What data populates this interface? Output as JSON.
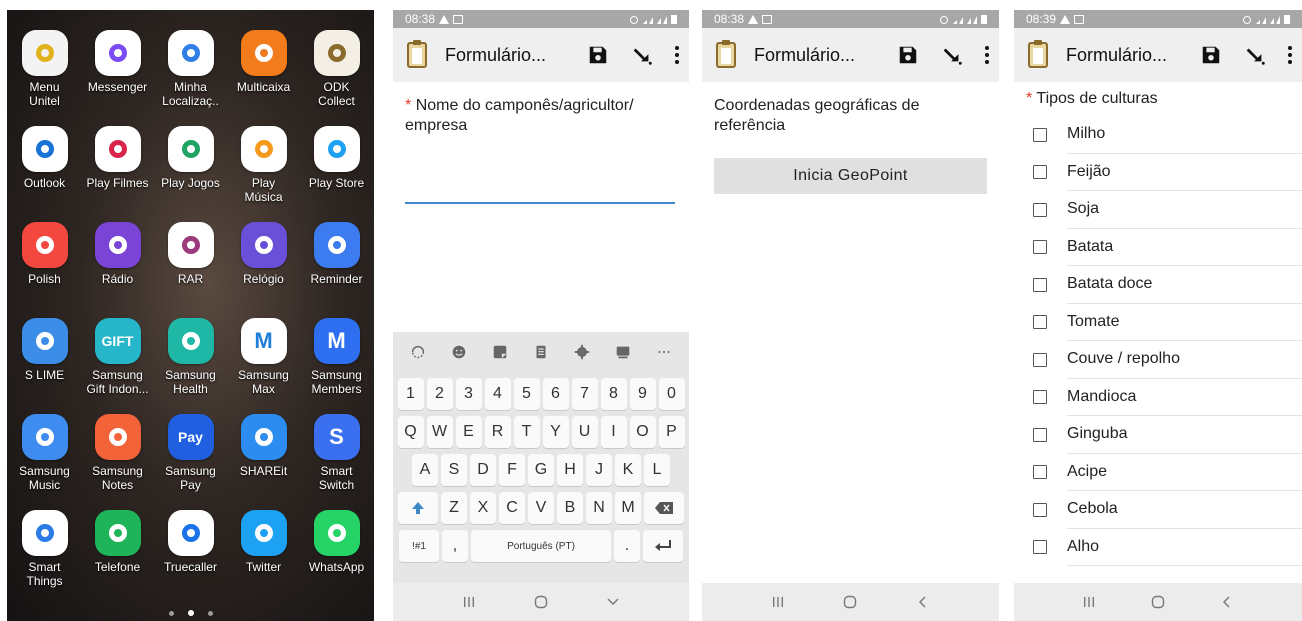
{
  "home": {
    "apps": [
      {
        "label": "Menu\nUnitel",
        "icon": "menu-unitel-icon",
        "bg": "#f3f3f3",
        "glyph": "",
        "fg": "#e2b21c"
      },
      {
        "label": "Messenger",
        "icon": "messenger-icon",
        "bg": "#ffffff",
        "glyph": "",
        "fg": "#7b4cf5"
      },
      {
        "label": "Minha\nLocalizaç..",
        "icon": "minha-localizacao-icon",
        "bg": "#ffffff",
        "glyph": "",
        "fg": "#2f7fe6"
      },
      {
        "label": "Multicaixa",
        "icon": "multicaixa-icon",
        "bg": "#f27b1b",
        "glyph": "",
        "fg": "#ffffff"
      },
      {
        "label": "ODK\nCollect",
        "icon": "odk-collect-icon",
        "bg": "#f3efe4",
        "glyph": "",
        "fg": "#8b6b2b"
      },
      {
        "label": "Outlook",
        "icon": "outlook-icon",
        "bg": "#ffffff",
        "glyph": "",
        "fg": "#1773d6"
      },
      {
        "label": "Play Filmes",
        "icon": "play-filmes-icon",
        "bg": "#ffffff",
        "glyph": "",
        "fg": "#d8234a"
      },
      {
        "label": "Play Jogos",
        "icon": "play-jogos-icon",
        "bg": "#ffffff",
        "glyph": "",
        "fg": "#1fa463"
      },
      {
        "label": "Play\nMúsica",
        "icon": "play-musica-icon",
        "bg": "#ffffff",
        "glyph": "",
        "fg": "#f59a1c"
      },
      {
        "label": "Play Store",
        "icon": "play-store-icon",
        "bg": "#ffffff",
        "glyph": "",
        "fg": "#1ea1f2"
      },
      {
        "label": "Polish",
        "icon": "polish-icon",
        "bg": "#f2483f",
        "glyph": "",
        "fg": "#ffffff"
      },
      {
        "label": "Rádio",
        "icon": "radio-icon",
        "bg": "#7a45d6",
        "glyph": "",
        "fg": "#ffffff"
      },
      {
        "label": "RAR",
        "icon": "rar-icon",
        "bg": "#ffffff",
        "glyph": "",
        "fg": "#9b3a7c"
      },
      {
        "label": "Relógio",
        "icon": "relogio-icon",
        "bg": "#6a4fd8",
        "glyph": "",
        "fg": "#ffffff"
      },
      {
        "label": "Reminder",
        "icon": "reminder-icon",
        "bg": "#3d7cf0",
        "glyph": "",
        "fg": "#ffffff"
      },
      {
        "label": "S LIME",
        "icon": "s-lime-icon",
        "bg": "#3b8de8",
        "glyph": "",
        "fg": "#ffffff"
      },
      {
        "label": "Samsung\nGift Indon...",
        "icon": "samsung-gift-icon",
        "bg": "#27b6c9",
        "glyph": "GIFT",
        "fg": "#ffffff"
      },
      {
        "label": "Samsung\nHealth",
        "icon": "samsung-health-icon",
        "bg": "#1fb7a6",
        "glyph": "",
        "fg": "#ffffff"
      },
      {
        "label": "Samsung\nMax",
        "icon": "samsung-max-icon",
        "bg": "#ffffff",
        "glyph": "M",
        "fg": "#1f7fd9"
      },
      {
        "label": "Samsung\nMembers",
        "icon": "samsung-members-icon",
        "bg": "#2d6ff0",
        "glyph": "M",
        "fg": "#ffffff"
      },
      {
        "label": "Samsung\nMusic",
        "icon": "samsung-music-icon",
        "bg": "#3f8cf0",
        "glyph": "",
        "fg": "#ffffff"
      },
      {
        "label": "Samsung\nNotes",
        "icon": "samsung-notes-icon",
        "bg": "#f2633a",
        "glyph": "",
        "fg": "#ffffff"
      },
      {
        "label": "Samsung\nPay",
        "icon": "samsung-pay-icon",
        "bg": "#1f5fe0",
        "glyph": "Pay",
        "fg": "#ffffff"
      },
      {
        "label": "SHAREit",
        "icon": "shareit-icon",
        "bg": "#2d8cf0",
        "glyph": "",
        "fg": "#ffffff"
      },
      {
        "label": "Smart\nSwitch",
        "icon": "smart-switch-icon",
        "bg": "#3a6ff0",
        "glyph": "S",
        "fg": "#ffffff"
      },
      {
        "label": "Smart\nThings",
        "icon": "smart-things-icon",
        "bg": "#ffffff",
        "glyph": "",
        "fg": "#2d7be8"
      },
      {
        "label": "Telefone",
        "icon": "telefone-icon",
        "bg": "#1fb45a",
        "glyph": "",
        "fg": "#ffffff"
      },
      {
        "label": "Truecaller",
        "icon": "truecaller-icon",
        "bg": "#ffffff",
        "glyph": "",
        "fg": "#1a73e8"
      },
      {
        "label": "Twitter",
        "icon": "twitter-icon",
        "bg": "#1da1f2",
        "glyph": "",
        "fg": "#ffffff"
      },
      {
        "label": "WhatsApp",
        "icon": "whatsapp-icon",
        "bg": "#25d366",
        "glyph": "",
        "fg": "#ffffff"
      }
    ]
  },
  "status": {
    "time_1": "08:38",
    "time_2": "08:38",
    "time_3": "08:39"
  },
  "appbar": {
    "title": "Formulário..."
  },
  "form_text": {
    "question": "Nome do camponês/agricultor/ empresa",
    "required_mark": "*",
    "input_value": ""
  },
  "keyboard": {
    "rows": [
      [
        "1",
        "2",
        "3",
        "4",
        "5",
        "6",
        "7",
        "8",
        "9",
        "0"
      ],
      [
        "Q",
        "W",
        "E",
        "R",
        "T",
        "Y",
        "U",
        "I",
        "O",
        "P"
      ],
      [
        "A",
        "S",
        "D",
        "F",
        "G",
        "H",
        "J",
        "K",
        "L"
      ],
      [
        "Z",
        "X",
        "C",
        "V",
        "B",
        "N",
        "M"
      ]
    ],
    "symbols_key": "!#1",
    "comma_key": ",",
    "space_key": "Português (PT)",
    "period_key": "."
  },
  "form_geo": {
    "label": "Coordenadas geográficas de referência",
    "button": "Inicia GeoPoint"
  },
  "form_select": {
    "required_mark": "*",
    "question": "Tipos de culturas",
    "options": [
      "Milho",
      "Feijão",
      "Soja",
      "Batata",
      "Batata doce",
      "Tomate",
      "Couve / repolho",
      "Mandioca",
      "Ginguba",
      "Acipe",
      "Cebola",
      "Alho"
    ]
  },
  "colors": {
    "required": "#e33a2b",
    "input_underline": "#3d88c8",
    "appbar_bg": "#efefef"
  }
}
